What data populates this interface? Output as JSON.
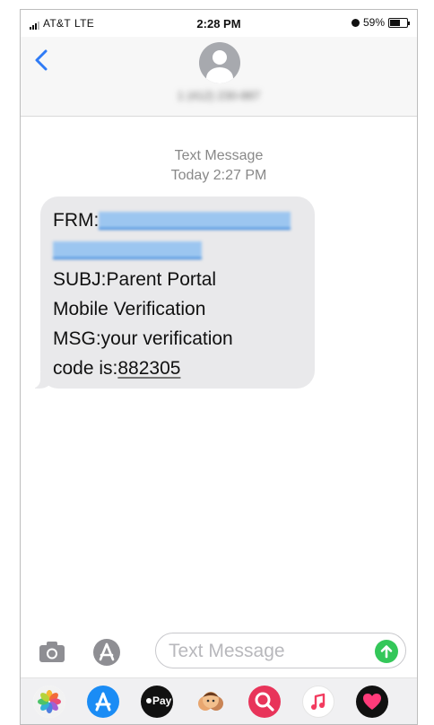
{
  "status_bar": {
    "carrier": "AT&T",
    "network": "LTE",
    "time": "2:28 PM",
    "battery": "59%",
    "battery_level": 0.59
  },
  "conversation": {
    "contact_number": "1 (412) 230-887"
  },
  "thread": {
    "timestamp_label": "Text Message",
    "timestamp_time": "Today 2:27 PM"
  },
  "message": {
    "from_label": "FRM:",
    "line_subject": "SUBJ:Parent Portal",
    "line_subject_2": "Mobile Verification",
    "line_msg": "MSG:your verification",
    "line_code_prefix": "code is:",
    "code": "882305"
  },
  "composer": {
    "placeholder": "Text Message"
  },
  "app_drawer": {
    "apps": [
      "photos",
      "app-store",
      "apple-pay",
      "memoji",
      "search-images",
      "music",
      "digital-touch"
    ],
    "apple_pay_label": "Pay"
  },
  "colors": {
    "accent_blue": "#2f7bf6",
    "send_green": "#34c759",
    "bubble_gray": "#e9e9eb"
  }
}
